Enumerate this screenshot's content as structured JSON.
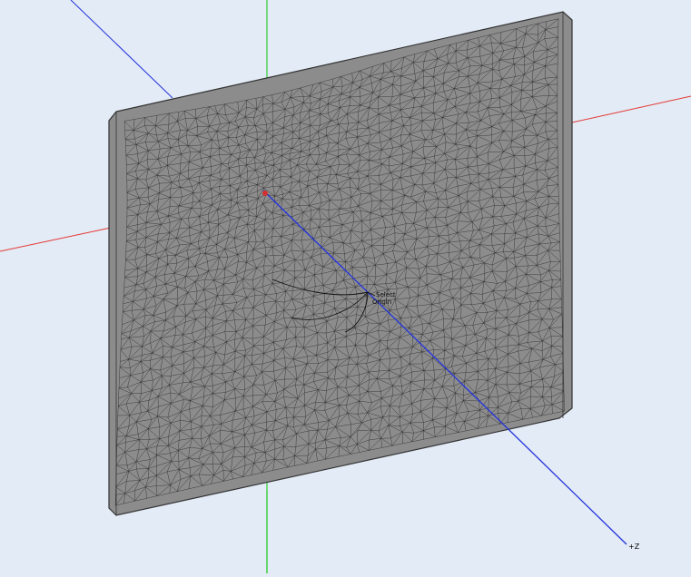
{
  "viewport": {
    "background": "#e3ebf6",
    "axes": {
      "x_color": "#e53935",
      "y_color": "#33cc33",
      "z_color": "#2233dd",
      "z_label": "+Z"
    },
    "mesh": {
      "fill": "#8c8c8c",
      "edge_color": "#222222",
      "frame_color": "#333333"
    },
    "annotations": {
      "label_top": "Select",
      "label_bottom": "Origin"
    }
  }
}
